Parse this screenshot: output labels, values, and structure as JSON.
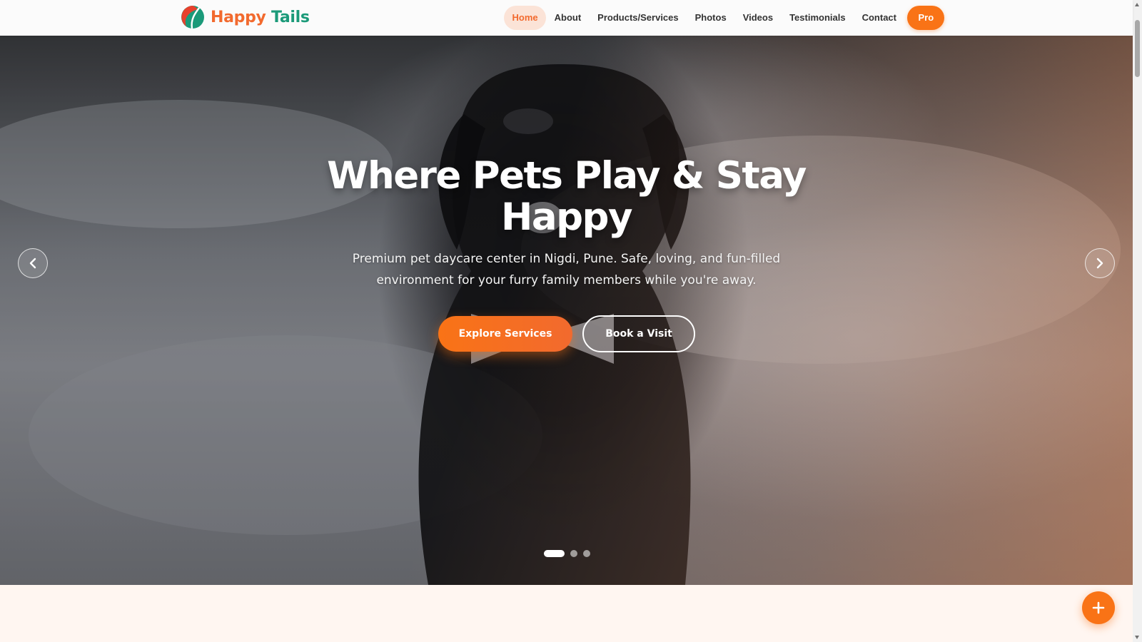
{
  "brand": {
    "word1": "Happy",
    "word2": "Tails",
    "colors": {
      "orange": "#f26a2e",
      "green": "#1b9a79"
    }
  },
  "nav": {
    "items": [
      {
        "label": "Home",
        "active": true
      },
      {
        "label": "About",
        "active": false
      },
      {
        "label": "Products/Services",
        "active": false
      },
      {
        "label": "Photos",
        "active": false
      },
      {
        "label": "Videos",
        "active": false
      },
      {
        "label": "Testimonials",
        "active": false
      },
      {
        "label": "Contact",
        "active": false
      }
    ],
    "pro_label": "Pro"
  },
  "hero": {
    "title": "Where Pets Play & Stay Happy",
    "subtitle": "Premium pet daycare center in Nigdi, Pune. Safe, loving, and fun-filled environment for your furry family members while you're away.",
    "primary_button": "Explore Services",
    "secondary_button": "Book a Visit",
    "slides_total": 3,
    "active_slide": 1
  },
  "icons": {
    "prev": "chevron-left-icon",
    "next": "chevron-right-icon",
    "fab": "plus-icon",
    "logo": "logo-mark-icon"
  },
  "accent_color": "#f97316"
}
